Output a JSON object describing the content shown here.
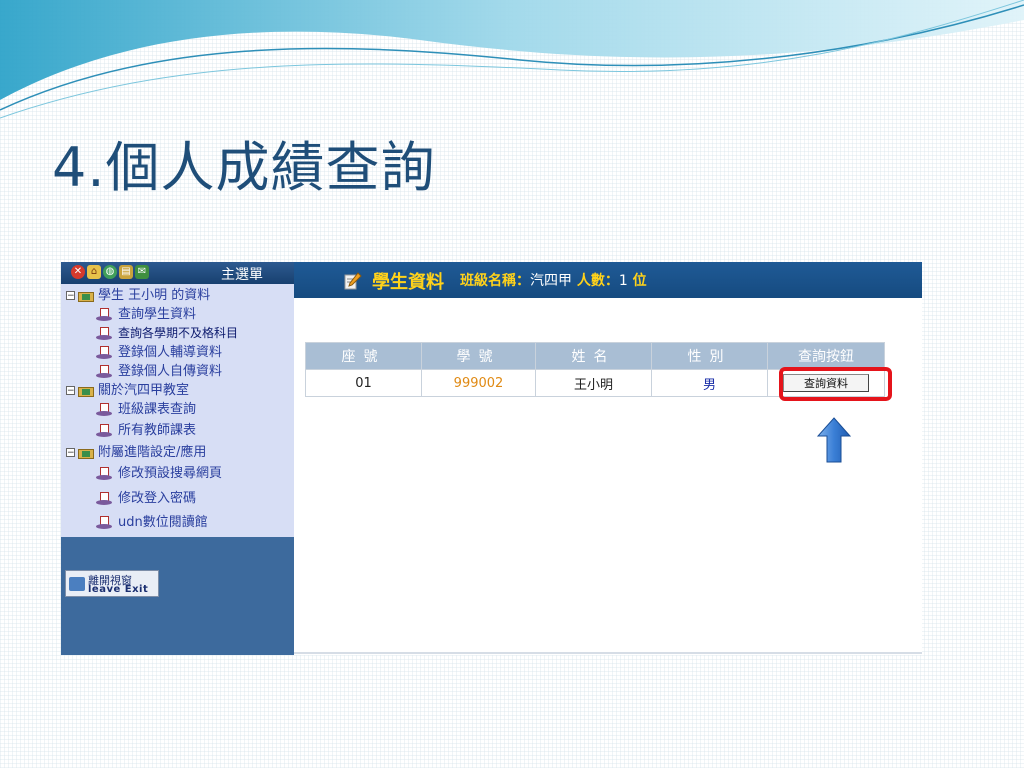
{
  "slide": {
    "title": "4.個人成績查詢"
  },
  "sidebar": {
    "title": "主選單",
    "icons": [
      "close-icon",
      "home-icon",
      "globe-icon",
      "folder-icon",
      "mail-icon"
    ],
    "groups": [
      {
        "label": "學生 王小明 的資料",
        "items": [
          "查詢學生資料",
          "查詢各學期不及格科目",
          "登錄個人輔導資料",
          "登錄個人自傳資料"
        ]
      },
      {
        "label": "關於汽四甲教室",
        "items": [
          "班級課表查詢",
          "所有教師課表"
        ]
      },
      {
        "label": "附屬進階設定/應用",
        "items": [
          "修改預設搜尋網頁",
          "修改登入密碼",
          "udn數位閱讀館"
        ]
      }
    ],
    "leave": {
      "line1": "離開視窗",
      "line2": "leave Exit"
    }
  },
  "main": {
    "header_title": "學生資料",
    "class_label": "班級名稱：",
    "class_value": "汽四甲",
    "count_label": "人數：",
    "count_value": "1",
    "count_unit": "位",
    "table": {
      "headers": [
        "座號",
        "學號",
        "姓名",
        "性別",
        "查詢按鈕"
      ],
      "rows": [
        {
          "seat": "01",
          "student_id": "999002",
          "name": "王小明",
          "gender": "男",
          "button": "查詢資料"
        }
      ]
    }
  },
  "colors": {
    "accent_red": "#e5141b",
    "header_blue": "#1f5a96",
    "yellow": "#ffd21a",
    "arrow_blue": "#3b7fd6"
  }
}
